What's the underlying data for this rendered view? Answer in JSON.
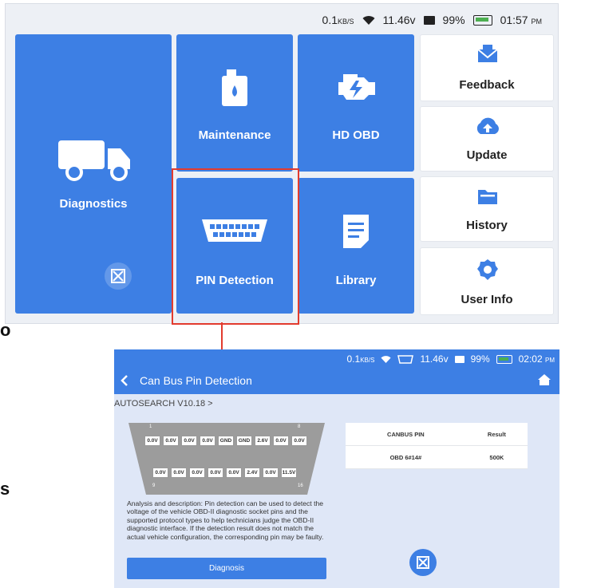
{
  "top_screen": {
    "status": {
      "speed": "0.1",
      "speed_unit": "KB/S",
      "voltage": "11.46v",
      "battery": "99%",
      "time": "01:57",
      "ampm": "PM"
    },
    "tiles": {
      "diagnostics": "Diagnostics",
      "maintenance": "Maintenance",
      "hd_obd": "HD OBD",
      "pin_detection": "PIN Detection",
      "library": "Library"
    },
    "side": {
      "feedback": "Feedback",
      "update": "Update",
      "history": "History",
      "user_info": "User Info"
    }
  },
  "edge_fragments": {
    "first": "o",
    "second": "s"
  },
  "bottom_screen": {
    "status": {
      "speed": "0.1",
      "speed_unit": "KB/S",
      "voltage": "11.46v",
      "battery": "99%",
      "time": "02:02",
      "ampm": "PM"
    },
    "title": "Can Bus Pin Detection",
    "breadcrumb": "AUTOSEARCH V10.18 >",
    "pins_top": [
      "0.0V",
      "0.0V",
      "0.0V",
      "0.0V",
      "GND",
      "GND",
      "2.6V",
      "0.0V",
      "0.0V"
    ],
    "pins_bottom": [
      "0.0V",
      "0.0V",
      "0.0V",
      "0.0V",
      "0.0V",
      "2.4V",
      "0.0V",
      "11.5V"
    ],
    "pin_numbers": {
      "one": "1",
      "eight": "8",
      "nine": "9",
      "sixteen": "16"
    },
    "description": "Analysis and description: Pin detection can be used to detect the voltage of the vehicle OBD-II diagnostic socket pins and the supported protocol types to help technicians judge the OBD-II diagnostic interface. If the detection result does not match the actual vehicle configuration, the corresponding pin may be faulty.",
    "diagnosis_button": "Diagnosis",
    "table": {
      "headers": [
        "CANBUS PIN",
        "Result"
      ],
      "rows": [
        [
          "OBD 6#14#",
          "500K"
        ]
      ]
    }
  },
  "colors": {
    "brand_blue": "#3d7fe4",
    "highlight_red": "#e23b2e"
  }
}
